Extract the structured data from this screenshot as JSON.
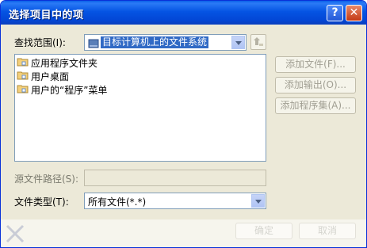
{
  "window": {
    "title": "选择项目中的项",
    "help_glyph": "?",
    "close_glyph": "✕"
  },
  "lookin": {
    "label": "查找范围(I):",
    "value": "目标计算机上的文件系统"
  },
  "items": [
    {
      "label": "应用程序文件夹",
      "icon": "folder-special-icon"
    },
    {
      "label": "用户桌面",
      "icon": "folder-special-icon"
    },
    {
      "label": "用户的“程序”菜单",
      "icon": "folder-special-icon"
    }
  ],
  "side_buttons": {
    "add_file": "添加文件(F)...",
    "add_output": "添加输出(O)...",
    "add_assembly": "添加程序集(A)..."
  },
  "source_path": {
    "label": "源文件路径(S):",
    "value": ""
  },
  "file_type": {
    "label": "文件类型(T):",
    "value": "所有文件(*.*)"
  },
  "footer": {
    "ok": "确定",
    "cancel": "取消"
  },
  "colors": {
    "titlebar": "#0554e3",
    "dialog_bg": "#ece9d8",
    "selection": "#316ac5",
    "disabled_text": "#a19f93"
  }
}
